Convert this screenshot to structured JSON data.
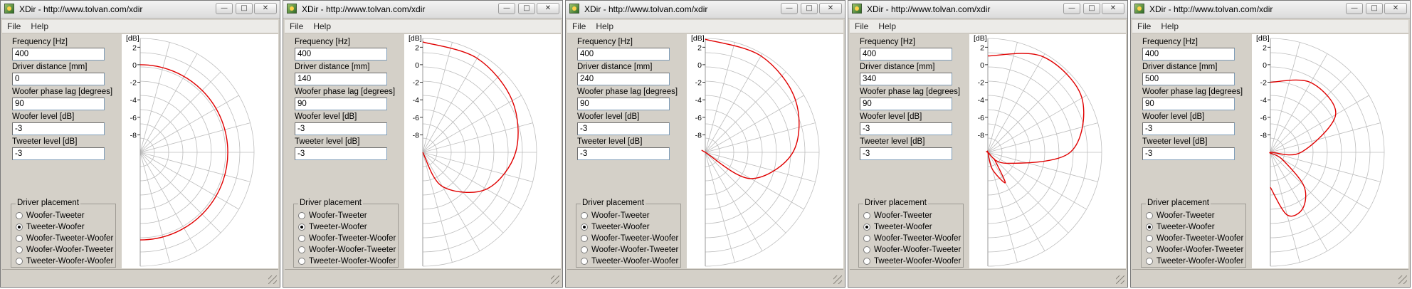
{
  "windows": [
    {
      "title": "XDir - http://www.tolvan.com/xdir",
      "menu": [
        "File",
        "Help"
      ],
      "fields": [
        {
          "label": "Frequency [Hz]",
          "value": "400"
        },
        {
          "label": "Driver distance [mm]",
          "value": "0"
        },
        {
          "label": "Woofer phase lag [degrees]",
          "value": "90"
        },
        {
          "label": "Woofer level [dB]",
          "value": "-3"
        },
        {
          "label": "Tweeter level [dB]",
          "value": "-3"
        }
      ],
      "placement": {
        "title": "Driver placement",
        "options": [
          "Woofer-Tweeter",
          "Tweeter-Woofer",
          "Woofer-Tweeter-Woofer",
          "Woofer-Woofer-Tweeter",
          "Tweeter-Woofer-Woofer"
        ],
        "selected": 1
      },
      "chart_data": {
        "type": "polar-line",
        "unit_label": "[dB]",
        "radial_ticks": [
          "2",
          "0",
          "-2",
          "-4",
          "-6",
          "-8"
        ],
        "rlim": [
          -10,
          3
        ],
        "angle_range_deg": [
          -90,
          90
        ],
        "grid": true,
        "series": [
          {
            "color": "#e00000",
            "angles_deg": [
              -90,
              -60,
              -30,
              0,
              30,
              60,
              90
            ],
            "values_db": [
              0,
              0,
              0,
              0,
              0,
              0,
              0
            ]
          }
        ]
      }
    },
    {
      "title": "XDir - http://www.tolvan.com/xdir",
      "menu": [
        "File",
        "Help"
      ],
      "fields": [
        {
          "label": "Frequency [Hz]",
          "value": "400"
        },
        {
          "label": "Driver distance [mm]",
          "value": "140"
        },
        {
          "label": "Woofer phase lag [degrees]",
          "value": "90"
        },
        {
          "label": "Woofer level [dB]",
          "value": "-3"
        },
        {
          "label": "Tweeter level [dB]",
          "value": "-3"
        }
      ],
      "placement": {
        "title": "Driver placement",
        "options": [
          "Woofer-Tweeter",
          "Tweeter-Woofer",
          "Woofer-Tweeter-Woofer",
          "Woofer-Woofer-Tweeter",
          "Tweeter-Woofer-Woofer"
        ],
        "selected": 1
      },
      "chart_data": {
        "type": "polar-line",
        "unit_label": "[dB]",
        "radial_ticks": [
          "2",
          "0",
          "-2",
          "-4",
          "-6",
          "-8"
        ],
        "rlim": [
          -10,
          3
        ],
        "angle_range_deg": [
          -90,
          90
        ],
        "grid": true,
        "series": [
          {
            "color": "#e00000",
            "angles_deg": [
              -90,
              -60,
              -30,
              0,
              30,
              60,
              90
            ],
            "values_db": [
              2.6,
              2.4,
              1.8,
              0.6,
              -1.6,
              -5.5,
              -10
            ]
          }
        ]
      }
    },
    {
      "title": "XDir - http://www.tolvan.com/xdir",
      "menu": [
        "File",
        "Help"
      ],
      "fields": [
        {
          "label": "Frequency [Hz]",
          "value": "400"
        },
        {
          "label": "Driver distance [mm]",
          "value": "240"
        },
        {
          "label": "Woofer phase lag [degrees]",
          "value": "90"
        },
        {
          "label": "Woofer level [dB]",
          "value": "-3"
        },
        {
          "label": "Tweeter level [dB]",
          "value": "-3"
        }
      ],
      "placement": {
        "title": "Driver placement",
        "options": [
          "Woofer-Tweeter",
          "Tweeter-Woofer",
          "Woofer-Tweeter-Woofer",
          "Woofer-Woofer-Tweeter",
          "Tweeter-Woofer-Woofer"
        ],
        "selected": 1
      },
      "chart_data": {
        "type": "polar-line",
        "unit_label": "[dB]",
        "radial_ticks": [
          "2",
          "0",
          "-2",
          "-4",
          "-6",
          "-8"
        ],
        "rlim": [
          -10,
          3
        ],
        "angle_range_deg": [
          -90,
          90
        ],
        "grid": true,
        "series": [
          {
            "color": "#e00000",
            "angles_deg": [
              -90,
              -60,
              -30,
              0,
              30,
              60,
              90
            ],
            "values_db": [
              2.9,
              2.7,
              1.9,
              0,
              -4,
              -10,
              -10
            ]
          }
        ]
      }
    },
    {
      "title": "XDir - http://www.tolvan.com/xdir",
      "menu": [
        "File",
        "Help"
      ],
      "fields": [
        {
          "label": "Frequency [Hz]",
          "value": "400"
        },
        {
          "label": "Driver distance [mm]",
          "value": "340"
        },
        {
          "label": "Woofer phase lag [degrees]",
          "value": "90"
        },
        {
          "label": "Woofer level [dB]",
          "value": "-3"
        },
        {
          "label": "Tweeter level [dB]",
          "value": "-3"
        }
      ],
      "placement": {
        "title": "Driver placement",
        "options": [
          "Woofer-Tweeter",
          "Tweeter-Woofer",
          "Woofer-Tweeter-Woofer",
          "Woofer-Woofer-Tweeter",
          "Tweeter-Woofer-Woofer"
        ],
        "selected": 1
      },
      "chart_data": {
        "type": "polar-line",
        "unit_label": "[dB]",
        "radial_ticks": [
          "2",
          "0",
          "-2",
          "-4",
          "-6",
          "-8"
        ],
        "rlim": [
          -10,
          3
        ],
        "angle_range_deg": [
          -90,
          90
        ],
        "grid": true,
        "series": [
          {
            "color": "#e00000",
            "angles_deg": [
              -90,
              -60,
              -30,
              0,
              30,
              60,
              75,
              90,
              75,
              60,
              45
            ],
            "values_db": [
              1,
              2.6,
              2.4,
              -0.6,
              -7.5,
              -10,
              -10,
              -10,
              -8,
              -6,
              -9
            ]
          }
        ]
      }
    },
    {
      "title": "XDir - http://www.tolvan.com/xdir",
      "menu": [
        "File",
        "Help"
      ],
      "fields": [
        {
          "label": "Frequency [Hz]",
          "value": "400"
        },
        {
          "label": "Driver distance [mm]",
          "value": "500"
        },
        {
          "label": "Woofer phase lag [degrees]",
          "value": "90"
        },
        {
          "label": "Woofer level [dB]",
          "value": "-3"
        },
        {
          "label": "Tweeter level [dB]",
          "value": "-3"
        }
      ],
      "placement": {
        "title": "Driver placement",
        "options": [
          "Woofer-Tweeter",
          "Tweeter-Woofer",
          "Woofer-Tweeter-Woofer",
          "Woofer-Woofer-Tweeter",
          "Tweeter-Woofer-Woofer"
        ],
        "selected": 1
      },
      "chart_data": {
        "type": "polar-line",
        "unit_label": "[dB]",
        "radial_ticks": [
          "2",
          "0",
          "-2",
          "-4",
          "-6",
          "-8"
        ],
        "rlim": [
          -10,
          3
        ],
        "angle_range_deg": [
          -90,
          90
        ],
        "grid": true,
        "series": [
          {
            "color": "#e00000",
            "angles_deg": [
              -90,
              -60,
              -30,
              0,
              15,
              30,
              45,
              60,
              75,
              90
            ],
            "values_db": [
              -2,
              -0.8,
              -1.4,
              -6.5,
              -10,
              -8.5,
              -4.6,
              -2.6,
              -2.6,
              -6
            ]
          }
        ]
      }
    }
  ]
}
